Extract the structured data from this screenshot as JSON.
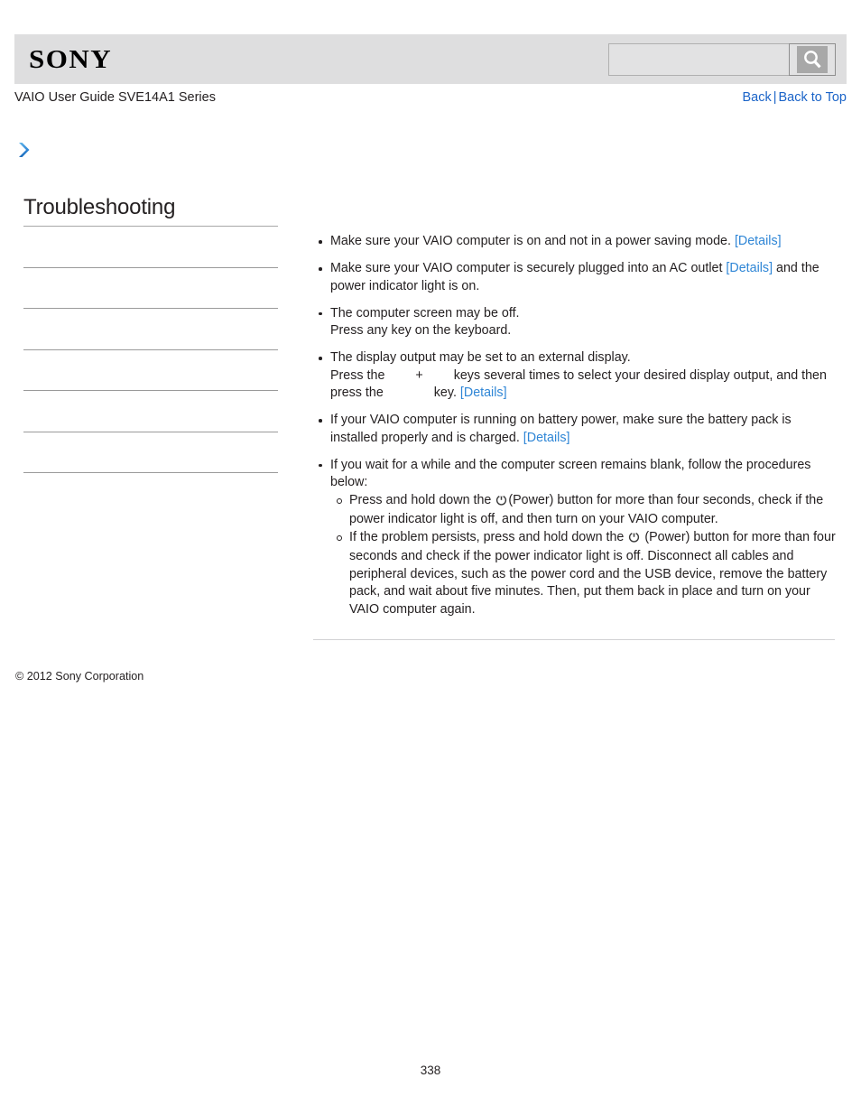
{
  "header": {
    "logo_text": "SONY",
    "search": {
      "value": "",
      "placeholder": "",
      "icon": "search-icon",
      "button_label": ""
    }
  },
  "subtitle": {
    "guide_title": "VAIO User Guide SVE14A1 Series",
    "links": [
      {
        "label": "Back"
      },
      {
        "label": "Back to Top"
      }
    ],
    "separator": "|",
    "link_color": "#1b64c8"
  },
  "sidebar": {
    "breadcrumb_icon": "chevron-right-icon",
    "heading": "Troubleshooting",
    "items": [
      {
        "label": ""
      },
      {
        "label": ""
      },
      {
        "label": ""
      },
      {
        "label": ""
      },
      {
        "label": ""
      },
      {
        "label": ""
      }
    ]
  },
  "content": {
    "bullets": [
      {
        "id": "power-saving-mode",
        "lines": [
          {
            "text": "Make sure your VAIO computer is on and not in a power saving mode. ",
            "link": "[Details]",
            "after": ""
          }
        ]
      },
      {
        "id": "ac-outlet",
        "lines": [
          {
            "text": "Make sure your VAIO computer is securely plugged into an AC outlet ",
            "link": "[Details]",
            "after": " and the power indicator light is on."
          }
        ]
      },
      {
        "id": "screen-off",
        "lines": [
          {
            "text": "The computer screen may be off.",
            "link": "",
            "after": ""
          },
          {
            "text": "Press any key on the keyboard.",
            "link": "",
            "after": ""
          }
        ]
      },
      {
        "id": "external-display",
        "lines": [
          {
            "text": "The display output may be set to an external display.",
            "link": "",
            "after": ""
          },
          {
            "text": "Press the ",
            "key_gap": true,
            "plus": "+",
            "text2": " keys several times to select your desired display output, and then press the ",
            "key_gap2": true,
            "text3": " key. ",
            "link": "[Details]",
            "after": ""
          }
        ]
      },
      {
        "id": "battery-power",
        "lines": [
          {
            "text": "If your VAIO computer is running on battery power, make sure the battery pack is installed properly and is charged. ",
            "link": "[Details]",
            "after": ""
          }
        ]
      },
      {
        "id": "blank-screen-procedures",
        "lines": [
          {
            "text": "If you wait for a while and the computer screen remains blank, follow the procedures below:",
            "link": "",
            "after": ""
          }
        ],
        "subbullets": [
          {
            "id": "hold-power-four-seconds",
            "before": "Press and hold down the ",
            "icon": "power-icon",
            "after": "(Power) button for more than four seconds, check if the power indicator light is off, and then turn on your VAIO computer."
          },
          {
            "id": "disconnect-and-reset",
            "before": "If the problem persists, press and hold down the ",
            "icon": "power-icon",
            "after": " (Power) button for more than four seconds and check if the power indicator light is off. Disconnect all cables and peripheral devices, such as the power cord and the USB device, remove the battery pack, and wait about five minutes. Then, put them back in place and turn on your VAIO computer again."
          }
        ]
      }
    ]
  },
  "footer": {
    "copyright": "© 2012 Sony Corporation",
    "page_number": "338"
  },
  "colors": {
    "header_bg": "#dededf",
    "link_blue": "#2f86d6",
    "nav_blue": "#1b64c8",
    "chevron_blue": "#2f86d6",
    "rule_gray": "#9a9a9a",
    "text": "#231f20"
  }
}
